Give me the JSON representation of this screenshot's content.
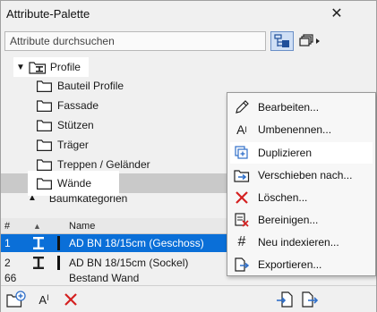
{
  "window": {
    "title": "Attribute-Palette",
    "close_glyph": "✕"
  },
  "search": {
    "placeholder": "Attribute durchsuchen"
  },
  "tree": {
    "root_label": "Profile",
    "children": [
      "Bauteil Profile",
      "Fassade",
      "Stützen",
      "Träger",
      "Treppen / Geländer",
      "Wände"
    ],
    "partial_next": "Baumkategorien"
  },
  "table": {
    "columns": [
      "#",
      "",
      "Name"
    ],
    "rows": [
      {
        "num": "1",
        "name": "AD BN 18/15cm (Geschoss)",
        "selected": true
      },
      {
        "num": "2",
        "name": "AD BN 18/15cm (Sockel)",
        "selected": false
      }
    ],
    "partial_row": {
      "num": "66",
      "name": "Bestand Wand"
    }
  },
  "context_menu": {
    "items": [
      {
        "label": "Bearbeiten...",
        "icon": "pencil-icon"
      },
      {
        "label": "Umbenennen...",
        "icon": "rename-icon"
      },
      {
        "label": "Duplizieren",
        "icon": "duplicate-icon"
      },
      {
        "label": "Verschieben nach...",
        "icon": "move-icon"
      },
      {
        "label": "Löschen...",
        "icon": "delete-icon"
      },
      {
        "label": "Bereinigen...",
        "icon": "purge-icon"
      },
      {
        "label": "Neu indexieren...",
        "icon": "hash-icon"
      },
      {
        "label": "Exportieren...",
        "icon": "export-icon"
      }
    ],
    "highlighted": "Duplizieren"
  },
  "colors": {
    "selection": "#0a6fd8",
    "accent_blue": "#2f6fc9",
    "delete_red": "#d42020"
  }
}
